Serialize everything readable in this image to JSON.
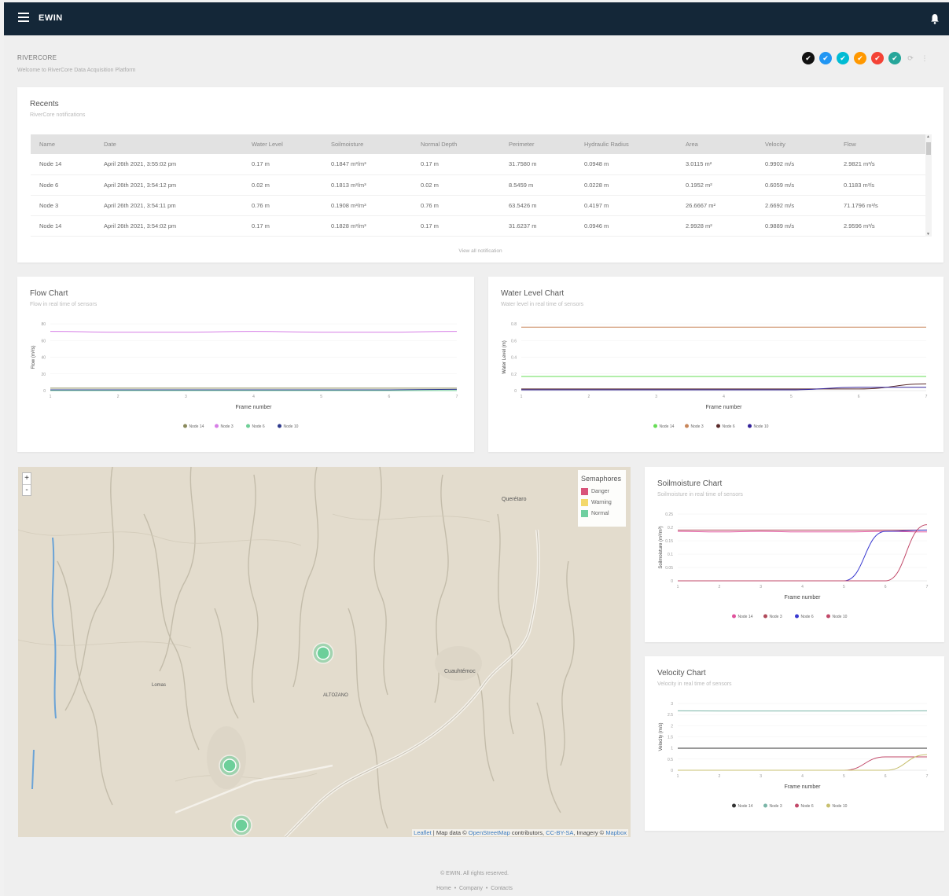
{
  "topbar": {
    "brand": "EWIN"
  },
  "header": {
    "title": "RIVERCORE",
    "subtitle": "Welcome to RiverCore Data Acquisition Platform"
  },
  "theme_swatches": [
    {
      "color": "#111111",
      "icon": "check-icon"
    },
    {
      "color": "#2196f3",
      "icon": "check-icon"
    },
    {
      "color": "#00bcd4",
      "icon": "check-icon"
    },
    {
      "color": "#ff9800",
      "icon": "check-icon"
    },
    {
      "color": "#f44336",
      "icon": "check-icon"
    },
    {
      "color": "#26a69a",
      "icon": "check-icon"
    }
  ],
  "recents": {
    "title": "Recents",
    "subtitle": "RiverCore notifications",
    "columns": [
      "Name",
      "Date",
      "Water Level",
      "Soilmoisture",
      "Normal Depth",
      "Perimeter",
      "Hydraulic Radius",
      "Area",
      "Velocity",
      "Flow"
    ],
    "rows": [
      [
        "Node 14",
        "April 26th 2021, 3:55:02 pm",
        "0.17 m",
        "0.1847 m³/m³",
        "0.17 m",
        "31.7580 m",
        "0.0948 m",
        "3.0115 m²",
        "0.9902 m/s",
        "2.9821 m³/s"
      ],
      [
        "Node 6",
        "April 26th 2021, 3:54:12 pm",
        "0.02 m",
        "0.1813 m³/m³",
        "0.02 m",
        "8.5459 m",
        "0.0228 m",
        "0.1952 m²",
        "0.6059 m/s",
        "0.1183 m³/s"
      ],
      [
        "Node 3",
        "April 26th 2021, 3:54:11 pm",
        "0.76 m",
        "0.1908 m³/m³",
        "0.76 m",
        "63.5426 m",
        "0.4197 m",
        "26.6667 m²",
        "2.6692 m/s",
        "71.1796 m³/s"
      ],
      [
        "Node 14",
        "April 26th 2021, 3:54:02 pm",
        "0.17 m",
        "0.1828 m³/m³",
        "0.17 m",
        "31.6237 m",
        "0.0946 m",
        "2.9928 m²",
        "0.9889 m/s",
        "2.9596 m³/s"
      ]
    ],
    "view_all": "View all notification"
  },
  "charts_meta": {
    "flow": {
      "title": "Flow Chart",
      "subtitle": "Flow in real time of sensors"
    },
    "water": {
      "title": "Water Level Chart",
      "subtitle": "Water level in real time of sensors"
    },
    "soil": {
      "title": "Soilmoisture Chart",
      "subtitle": "Soilmoisture in real time of sensors"
    },
    "velocity": {
      "title": "Velocity Chart",
      "subtitle": "Velocity in real time of sensors"
    }
  },
  "chart_data": [
    {
      "id": "flow",
      "type": "line",
      "xlabel": "Frame number",
      "ylabel": "Flow (m³/s)",
      "x": [
        1,
        2,
        3,
        4,
        5,
        6,
        7
      ],
      "ylim": [
        0,
        80
      ],
      "yticks": [
        0,
        20,
        40,
        60,
        80
      ],
      "series": [
        {
          "name": "Node 14",
          "color": "#8a8a5c",
          "values": [
            2.9,
            2.9,
            2.9,
            2.9,
            2.9,
            2.9,
            2.9
          ]
        },
        {
          "name": "Node 3",
          "color": "#d67ee6",
          "values": [
            71,
            70,
            70,
            71,
            70,
            70,
            71
          ]
        },
        {
          "name": "Node 6",
          "color": "#6fcf97",
          "values": [
            0.1,
            0.1,
            0.1,
            0.1,
            0.1,
            0.1,
            0.1
          ]
        },
        {
          "name": "Node 10",
          "color": "#2e3a8c",
          "values": [
            1,
            1,
            1,
            1,
            1,
            1,
            1.5
          ]
        }
      ]
    },
    {
      "id": "water",
      "type": "line",
      "xlabel": "Frame number",
      "ylabel": "Water Level (m)",
      "x": [
        1,
        2,
        3,
        4,
        5,
        6,
        7
      ],
      "ylim": [
        0,
        0.8
      ],
      "yticks": [
        0,
        0.2,
        0.4,
        0.6,
        0.8
      ],
      "series": [
        {
          "name": "Node 14",
          "color": "#66dd55",
          "values": [
            0.17,
            0.17,
            0.17,
            0.17,
            0.17,
            0.17,
            0.17
          ]
        },
        {
          "name": "Node 3",
          "color": "#c8865a",
          "values": [
            0.76,
            0.76,
            0.76,
            0.76,
            0.76,
            0.76,
            0.76
          ]
        },
        {
          "name": "Node 6",
          "color": "#5a2a2a",
          "values": [
            0.02,
            0.02,
            0.02,
            0.02,
            0.02,
            0.02,
            0.08
          ]
        },
        {
          "name": "Node 10",
          "color": "#332299",
          "values": [
            0.01,
            0.01,
            0.01,
            0.01,
            0.01,
            0.04,
            0.04
          ]
        }
      ]
    },
    {
      "id": "soil",
      "type": "line",
      "xlabel": "Frame number",
      "ylabel": "Soilmoisture (m³/m³)",
      "x": [
        1,
        2,
        3,
        4,
        5,
        6,
        7
      ],
      "ylim": [
        0,
        0.25
      ],
      "yticks": [
        0,
        0.05,
        0.1,
        0.15,
        0.2,
        0.25
      ],
      "series": [
        {
          "name": "Node 14",
          "color": "#e0529c",
          "values": [
            0.185,
            0.183,
            0.185,
            0.183,
            0.183,
            0.185,
            0.183
          ]
        },
        {
          "name": "Node 3",
          "color": "#b04a5a",
          "values": [
            0.19,
            0.19,
            0.19,
            0.19,
            0.19,
            0.19,
            0.19
          ]
        },
        {
          "name": "Node 6",
          "color": "#3a3ad0",
          "values": [
            0,
            0,
            0,
            0,
            0,
            0.185,
            0.19
          ]
        },
        {
          "name": "Node 10",
          "color": "#c24a6a",
          "values": [
            0,
            0,
            0,
            0,
            0,
            0,
            0.21
          ]
        }
      ]
    },
    {
      "id": "velocity",
      "type": "line",
      "xlabel": "Frame number",
      "ylabel": "Velocity (m/s)",
      "x": [
        1,
        2,
        3,
        4,
        5,
        6,
        7
      ],
      "ylim": [
        0,
        3
      ],
      "yticks": [
        0,
        0.5,
        1,
        1.5,
        2,
        2.5,
        3
      ],
      "series": [
        {
          "name": "Node 14",
          "color": "#333333",
          "values": [
            0.99,
            0.99,
            0.99,
            0.99,
            0.99,
            0.99,
            0.99
          ]
        },
        {
          "name": "Node 3",
          "color": "#7ab5a7",
          "values": [
            2.67,
            2.66,
            2.66,
            2.66,
            2.66,
            2.66,
            2.67
          ]
        },
        {
          "name": "Node 6",
          "color": "#c24a6a",
          "values": [
            0,
            0,
            0,
            0,
            0,
            0.6,
            0.6
          ]
        },
        {
          "name": "Node 10",
          "color": "#c8c070",
          "values": [
            0,
            0,
            0,
            0,
            0,
            0,
            0.7
          ]
        }
      ]
    }
  ],
  "map": {
    "legend_title": "Semaphores",
    "legend": [
      {
        "label": "Danger",
        "color": "#d9547a"
      },
      {
        "label": "Warning",
        "color": "#f3d86a"
      },
      {
        "label": "Normal",
        "color": "#6fcfa0"
      }
    ],
    "labels": {
      "queretaro": "Querétaro",
      "cuauhtemoc": "Cuauhtémoc",
      "altozano": "ALTOZANO",
      "lomas": "Lomas"
    },
    "zoom_in": "+",
    "zoom_out": "-",
    "attribution": {
      "leaflet": "Leaflet",
      "a1": " | Map data © ",
      "osm": "OpenStreetMap",
      "a2": " contributors, ",
      "cc": "CC-BY-SA",
      "a3": ", Imagery © ",
      "mapbox": "Mapbox"
    }
  },
  "footer": {
    "copyright": "© EWIN. All rights reserved.",
    "links": [
      "Home",
      "Company",
      "Contacts"
    ],
    "sep": "•"
  }
}
